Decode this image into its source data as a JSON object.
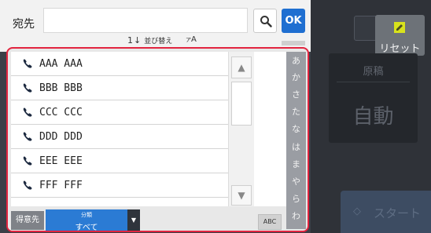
{
  "colors": {
    "accent": "#1f6fd1",
    "highlight_border": "#e2243f",
    "category_blue": "#2b7bd4",
    "dark_background": "#3b3f47"
  },
  "search": {
    "destination_label": "宛先",
    "input_value": "",
    "search_icon": "search-icon",
    "ok_label": "OK"
  },
  "sort": {
    "number_label": "1",
    "label": "並び替え",
    "kana_sort_small": "ア",
    "kana_sort_large": "A"
  },
  "contacts": [
    {
      "type_icon": "phone-icon",
      "name": "AAA AAA"
    },
    {
      "type_icon": "phone-icon",
      "name": "BBB BBB"
    },
    {
      "type_icon": "phone-icon",
      "name": "CCC CCC"
    },
    {
      "type_icon": "phone-icon",
      "name": "DDD DDD"
    },
    {
      "type_icon": "phone-icon",
      "name": "EEE EEE"
    },
    {
      "type_icon": "phone-icon",
      "name": "FFF FFF"
    }
  ],
  "kana_index": [
    "あ",
    "か",
    "さ",
    "た",
    "な",
    "は",
    "ま",
    "や",
    "ら",
    "わ"
  ],
  "bottom": {
    "favorites_label": "得意先",
    "category_caption": "分類",
    "category_value": "すべて",
    "abc_label": "ABC"
  },
  "background": {
    "reset_label": "リセット",
    "original_title": "原稿",
    "original_value": "自動",
    "start_label": "スタート"
  }
}
